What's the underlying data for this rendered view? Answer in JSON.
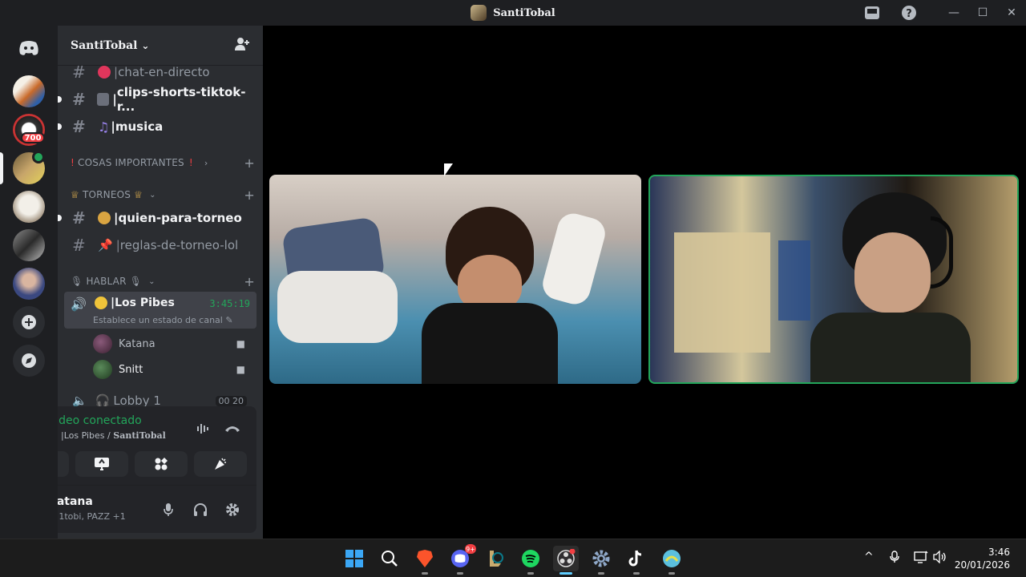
{
  "window": {
    "title": "SantiTobal",
    "controls": {
      "inbox": "inbox-icon",
      "help": "?",
      "minimize": "—",
      "maximize": "☐",
      "close": "✕"
    }
  },
  "servers": {
    "home_icon": "discord-logo",
    "badge_count": "700"
  },
  "guild": {
    "name": "SantiTobal",
    "chevron": "⌄",
    "invite_icon": "add-member-icon"
  },
  "channels": {
    "chat": "chat-en-directo",
    "clips": "clips-shorts-tiktok-r...",
    "musica": "musica",
    "cat_importantes": "COSAS IMPORTANTES",
    "cat_torneos": "TORNEOS",
    "quien": "quien-para-torneo",
    "reglas": "reglas-de-torneo-lol",
    "cat_hablar": "HABLAR",
    "hash": "#",
    "plus": "+"
  },
  "voice": {
    "channel_name": "Los Pibes",
    "duration": "3:45:19",
    "status": "Establece un estado de canal",
    "users": [
      "Katana",
      "Snitt"
    ],
    "lobby_name": "Lobby 1",
    "lobby_count_a": "00",
    "lobby_count_b": "20"
  },
  "voice_panel": {
    "title": "Video conectado",
    "subtitle_channel": "Los Pibes / ",
    "subtitle_server": "SantiTobal"
  },
  "user": {
    "name": "Katana",
    "activity": "1tobi, PAZZ +1"
  },
  "taskbar": {
    "discord_badge": "9+",
    "time": "3:46",
    "date": "20/01/2026"
  },
  "colors": {
    "accent_green": "#23a55a",
    "danger_red": "#f23f43",
    "sidebar_bg": "#2b2d31",
    "servers_bg": "#1e1f22"
  }
}
